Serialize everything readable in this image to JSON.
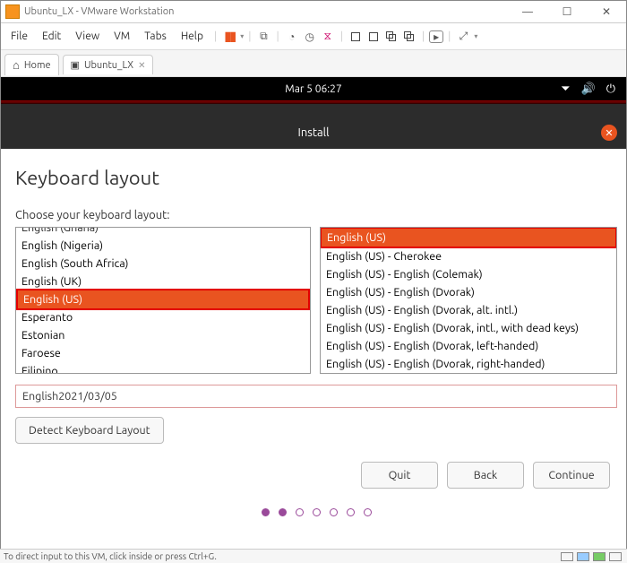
{
  "window": {
    "title": "Ubuntu_LX - VMware Workstation"
  },
  "menu": {
    "items": [
      "File",
      "Edit",
      "View",
      "VM",
      "Tabs",
      "Help"
    ]
  },
  "tabs": {
    "home": "Home",
    "vm": "Ubuntu_LX"
  },
  "ubuntu_bar": {
    "clock": "Mar 5  06:27"
  },
  "installer": {
    "title": "Install",
    "heading": "Keyboard layout",
    "prompt": "Choose your keyboard layout:",
    "left_list": [
      "English (Ghana)",
      "English (Nigeria)",
      "English (South Africa)",
      "English (UK)",
      "English (US)",
      "Esperanto",
      "Estonian",
      "Faroese",
      "Filipino"
    ],
    "left_selected_index": 4,
    "right_list": [
      "English (US)",
      "English (US) - Cherokee",
      "English (US) - English (Colemak)",
      "English (US) - English (Dvorak)",
      "English (US) - English (Dvorak, alt. intl.)",
      "English (US) - English (Dvorak, intl., with dead keys)",
      "English (US) - English (Dvorak, left-handed)",
      "English (US) - English (Dvorak, right-handed)"
    ],
    "right_selected_index": 0,
    "test_input": "English2021/03/05",
    "detect_btn": "Detect Keyboard Layout",
    "nav": {
      "quit": "Quit",
      "back": "Back",
      "continue": "Continue"
    },
    "step_index": 1,
    "step_count": 7
  },
  "statusbar": {
    "hint": "To direct input to this VM, click inside or press Ctrl+G."
  }
}
